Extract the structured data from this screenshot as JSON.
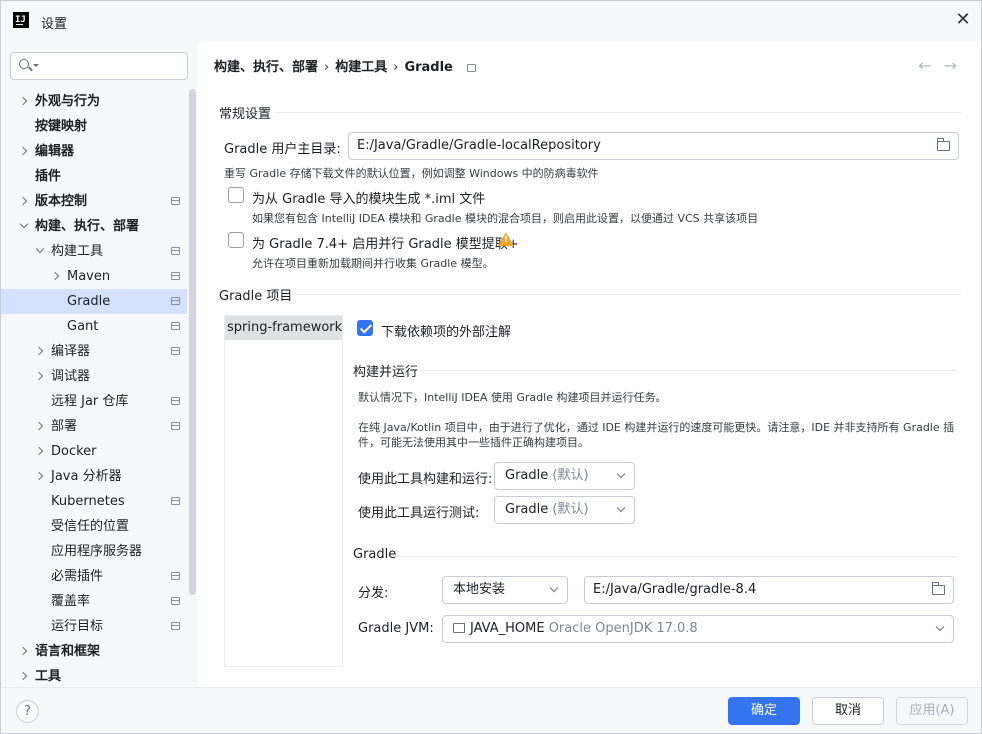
{
  "window": {
    "title": "设置"
  },
  "sidebar": {
    "search_placeholder": "",
    "items": [
      {
        "label": "外观与行为",
        "bold": true,
        "chevron": "right",
        "indent": 0,
        "proj": false
      },
      {
        "label": "按键映射",
        "bold": true,
        "chevron": "none",
        "indent": 0,
        "proj": false
      },
      {
        "label": "编辑器",
        "bold": true,
        "chevron": "right",
        "indent": 0,
        "proj": false
      },
      {
        "label": "插件",
        "bold": true,
        "chevron": "none",
        "indent": 0,
        "proj": false
      },
      {
        "label": "版本控制",
        "bold": true,
        "chevron": "right",
        "indent": 0,
        "proj": true
      },
      {
        "label": "构建、执行、部署",
        "bold": true,
        "chevron": "down",
        "indent": 0,
        "proj": false
      },
      {
        "label": "构建工具",
        "bold": false,
        "chevron": "down",
        "indent": 1,
        "proj": true
      },
      {
        "label": "Maven",
        "bold": false,
        "chevron": "right",
        "indent": 2,
        "proj": true
      },
      {
        "label": "Gradle",
        "bold": false,
        "chevron": "none",
        "indent": 2,
        "proj": true,
        "selected": true
      },
      {
        "label": "Gant",
        "bold": false,
        "chevron": "none",
        "indent": 2,
        "proj": true
      },
      {
        "label": "编译器",
        "bold": false,
        "chevron": "right",
        "indent": 1,
        "proj": true
      },
      {
        "label": "调试器",
        "bold": false,
        "chevron": "right",
        "indent": 1,
        "proj": false
      },
      {
        "label": "远程 Jar 仓库",
        "bold": false,
        "chevron": "none",
        "indent": 1,
        "proj": true
      },
      {
        "label": "部署",
        "bold": false,
        "chevron": "right",
        "indent": 1,
        "proj": true
      },
      {
        "label": "Docker",
        "bold": false,
        "chevron": "right",
        "indent": 1,
        "proj": false
      },
      {
        "label": "Java 分析器",
        "bold": false,
        "chevron": "right",
        "indent": 1,
        "proj": false
      },
      {
        "label": "Kubernetes",
        "bold": false,
        "chevron": "none",
        "indent": 1,
        "proj": true
      },
      {
        "label": "受信任的位置",
        "bold": false,
        "chevron": "none",
        "indent": 1,
        "proj": false
      },
      {
        "label": "应用程序服务器",
        "bold": false,
        "chevron": "none",
        "indent": 1,
        "proj": false
      },
      {
        "label": "必需插件",
        "bold": false,
        "chevron": "none",
        "indent": 1,
        "proj": true
      },
      {
        "label": "覆盖率",
        "bold": false,
        "chevron": "none",
        "indent": 1,
        "proj": true
      },
      {
        "label": "运行目标",
        "bold": false,
        "chevron": "none",
        "indent": 1,
        "proj": true
      },
      {
        "label": "语言和框架",
        "bold": true,
        "chevron": "right",
        "indent": 0,
        "proj": false
      },
      {
        "label": "工具",
        "bold": true,
        "chevron": "right",
        "indent": 0,
        "proj": false
      }
    ]
  },
  "breadcrumb": {
    "part1": "构建、执行、部署",
    "part2": "构建工具",
    "part3": "Gradle",
    "sep": "›"
  },
  "nav": {
    "back": "←",
    "forward": "→"
  },
  "general": {
    "title": "常规设置",
    "user_home_label": "Gradle 用户主目录:",
    "user_home_value": "E:/Java/Gradle/Gradle-localRepository",
    "user_home_hint": "重写 Gradle 存储下载文件的默认位置，例如调整 Windows 中的防病毒软件",
    "iml_label": "为从 Gradle 导入的模块生成 *.iml 文件",
    "iml_checked": false,
    "iml_hint": "如果您有包含 IntelliJ IDEA 模块和 Gradle 模块的混合项目，则启用此设置，以便通过 VCS 共享该项目",
    "parallel_label": "为 Gradle 7.4+ 启用并行 Gradle 模型提取+",
    "parallel_checked": false,
    "parallel_hint": "允许在项目重新加载期间并行收集 Gradle 模型。"
  },
  "project": {
    "title": "Gradle 项目",
    "list": [
      "spring-framework"
    ],
    "download_annotations_label": "下载依赖项的外部注解",
    "download_annotations_checked": true,
    "build_run": {
      "title": "构建并运行",
      "desc1": "默认情况下，IntelliJ IDEA 使用 Gradle 构建项目并运行任务。",
      "desc2a": "在纯 Java/Kotlin 项目中，由于进行了优化，通过 IDE 构建并运行的速度可能更快。请注意，IDE 并非支持所有 Gradle 插",
      "desc2b": "件，可能无法使用其中一些插件正确构建项目。",
      "build_with_label": "使用此工具构建和运行:",
      "build_with_value": "Gradle",
      "build_with_suffix": "(默认)",
      "test_with_label": "使用此工具运行测试:",
      "test_with_value": "Gradle",
      "test_with_suffix": "(默认)"
    },
    "gradle": {
      "title": "Gradle",
      "dist_label": "分发:",
      "dist_value": "本地安装",
      "dist_path": "E:/Java/Gradle/gradle-8.4",
      "jvm_label": "Gradle JVM:",
      "jvm_value": "JAVA_HOME",
      "jvm_detail": "Oracle OpenJDK 17.0.8"
    }
  },
  "footer": {
    "help": "?",
    "ok": "确定",
    "cancel": "取消",
    "apply": "应用(A)"
  },
  "colors": {
    "accent": "#3574f0",
    "selection": "#d5e1ff",
    "warning": "#f0a732"
  }
}
